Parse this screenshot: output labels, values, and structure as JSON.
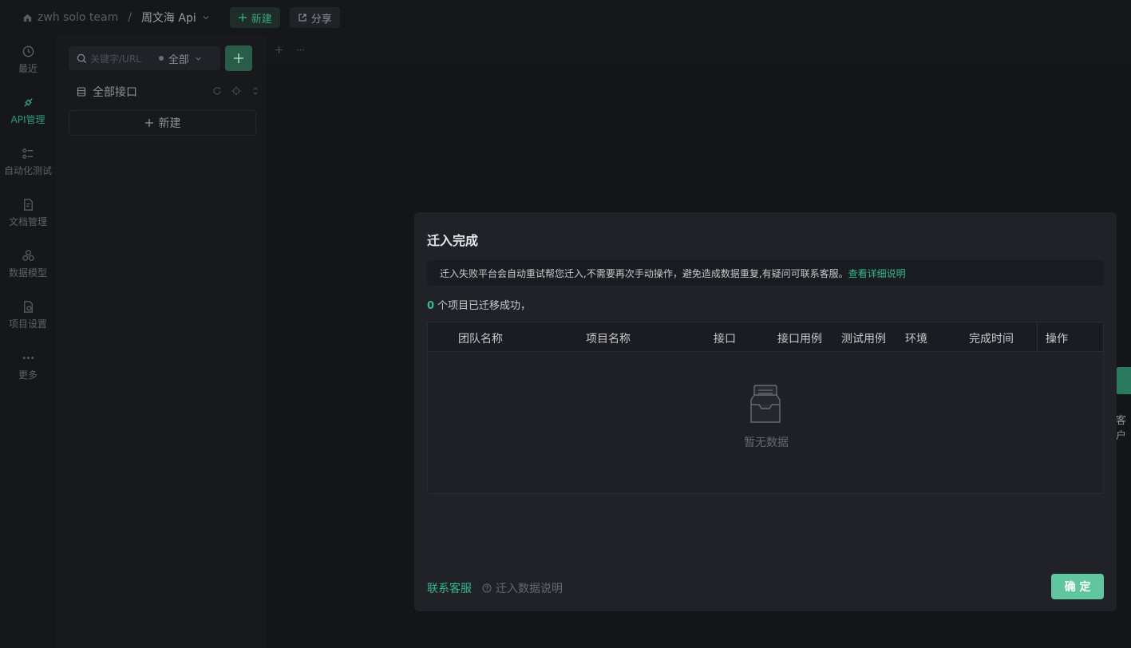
{
  "topbar": {
    "team": "zwh solo team",
    "separator": "/",
    "project": "周文海 Api",
    "new_label": "新建",
    "share_label": "分享"
  },
  "leftnav": {
    "items": [
      {
        "label": "最近",
        "icon": "clock-icon"
      },
      {
        "label": "API管理",
        "icon": "api-icon",
        "active": true
      },
      {
        "label": "自动化测试",
        "icon": "automation-icon"
      },
      {
        "label": "文档管理",
        "icon": "document-icon"
      },
      {
        "label": "数据模型",
        "icon": "data-model-icon"
      },
      {
        "label": "项目设置",
        "icon": "settings-icon"
      },
      {
        "label": "更多",
        "icon": "more-icon"
      }
    ]
  },
  "apipanel": {
    "search_placeholder": "关键字/URL",
    "filter_value": "全部",
    "tree_root": "全部接口",
    "new_label": "新建"
  },
  "main": {
    "peek_text": "客户"
  },
  "modal": {
    "title": "迁入完成",
    "notice_text": "迁入失败平台会自动重试帮您迁入,不需要再次手动操作，避免造成数据重复,有疑问可联系客服。",
    "notice_link": "查看详细说明",
    "success_count": "0",
    "success_text": "个项目已迁移成功，",
    "columns": [
      "团队名称",
      "项目名称",
      "接口",
      "接口用例",
      "测试用例",
      "环境",
      "完成时间",
      "操作"
    ],
    "empty_text": "暂无数据",
    "contact_label": "联系客服",
    "help_label": "迁入数据说明",
    "ok_label": "确 定"
  },
  "colors": {
    "accent": "#34b88c",
    "ok_button": "#5fc6a0",
    "modal_bg": "#212228",
    "page_bg": "#141519"
  }
}
